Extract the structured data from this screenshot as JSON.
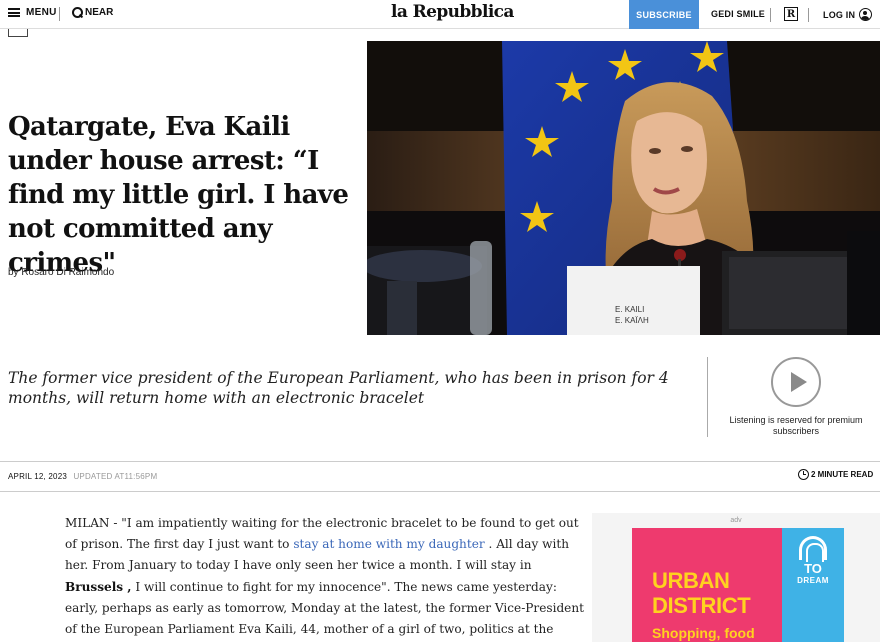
{
  "header": {
    "menu_label": "MENU",
    "near_label": "NEAR",
    "logo": "la Repubblica",
    "subscribe_label": "SUBSCRIBE",
    "gedi_label": "GEDI SMILE",
    "r_badge": "R",
    "login_label": "LOG IN"
  },
  "article": {
    "headline": "Qatargate, Eva Kaili under house arrest: “I find my little girl. I have not committed any crimes\"",
    "byline": "by Rosaro Di Raimondo",
    "summary": "The former vice president of the European Parliament, who has been in prison for 4 months, will return home with an electronic bracelet",
    "date": "APRIL 12, 2023",
    "updated": "UPDATED AT11:56PM",
    "read_time": "2 MINUTE READ",
    "body": {
      "p1_a": "MILAN - \"I am impatiently waiting for the electronic bracelet to be found to get out of prison. The first day I just want to ",
      "p1_link": "stay at home with my daughter",
      "p1_b": " . All day with her. From January to today I have only seen her twice a month. I will stay in ",
      "p1_bold": "Brussels ,",
      "p1_c": " I will continue to fight for my innocence\". The news came yesterday: early, perhaps as early as tomorrow, Monday at the latest, the former Vice-President of the European Parliament Eva Kaili, 44, mother of a girl of two, politics at the center of the \" Qatargate"
    }
  },
  "hero_image": {
    "nameplate_line1": "E. KAILI",
    "nameplate_line2": "E. KAΪΛΗ"
  },
  "audio": {
    "listen_note": "Listening is reserved for premium subscribers"
  },
  "ad": {
    "label": "adv",
    "brand_to": "TO",
    "brand_dream": "DREAM",
    "title_line1": "URBAN",
    "title_line2": "DISTRICT",
    "subtitle": "Shopping, food"
  },
  "colors": {
    "subscribe_bg": "#4a90d9",
    "link": "#3a67b8",
    "ad_pink": "#ee3a6e",
    "ad_yellow": "#ffd21f",
    "ad_blue": "#3fb2e6"
  }
}
